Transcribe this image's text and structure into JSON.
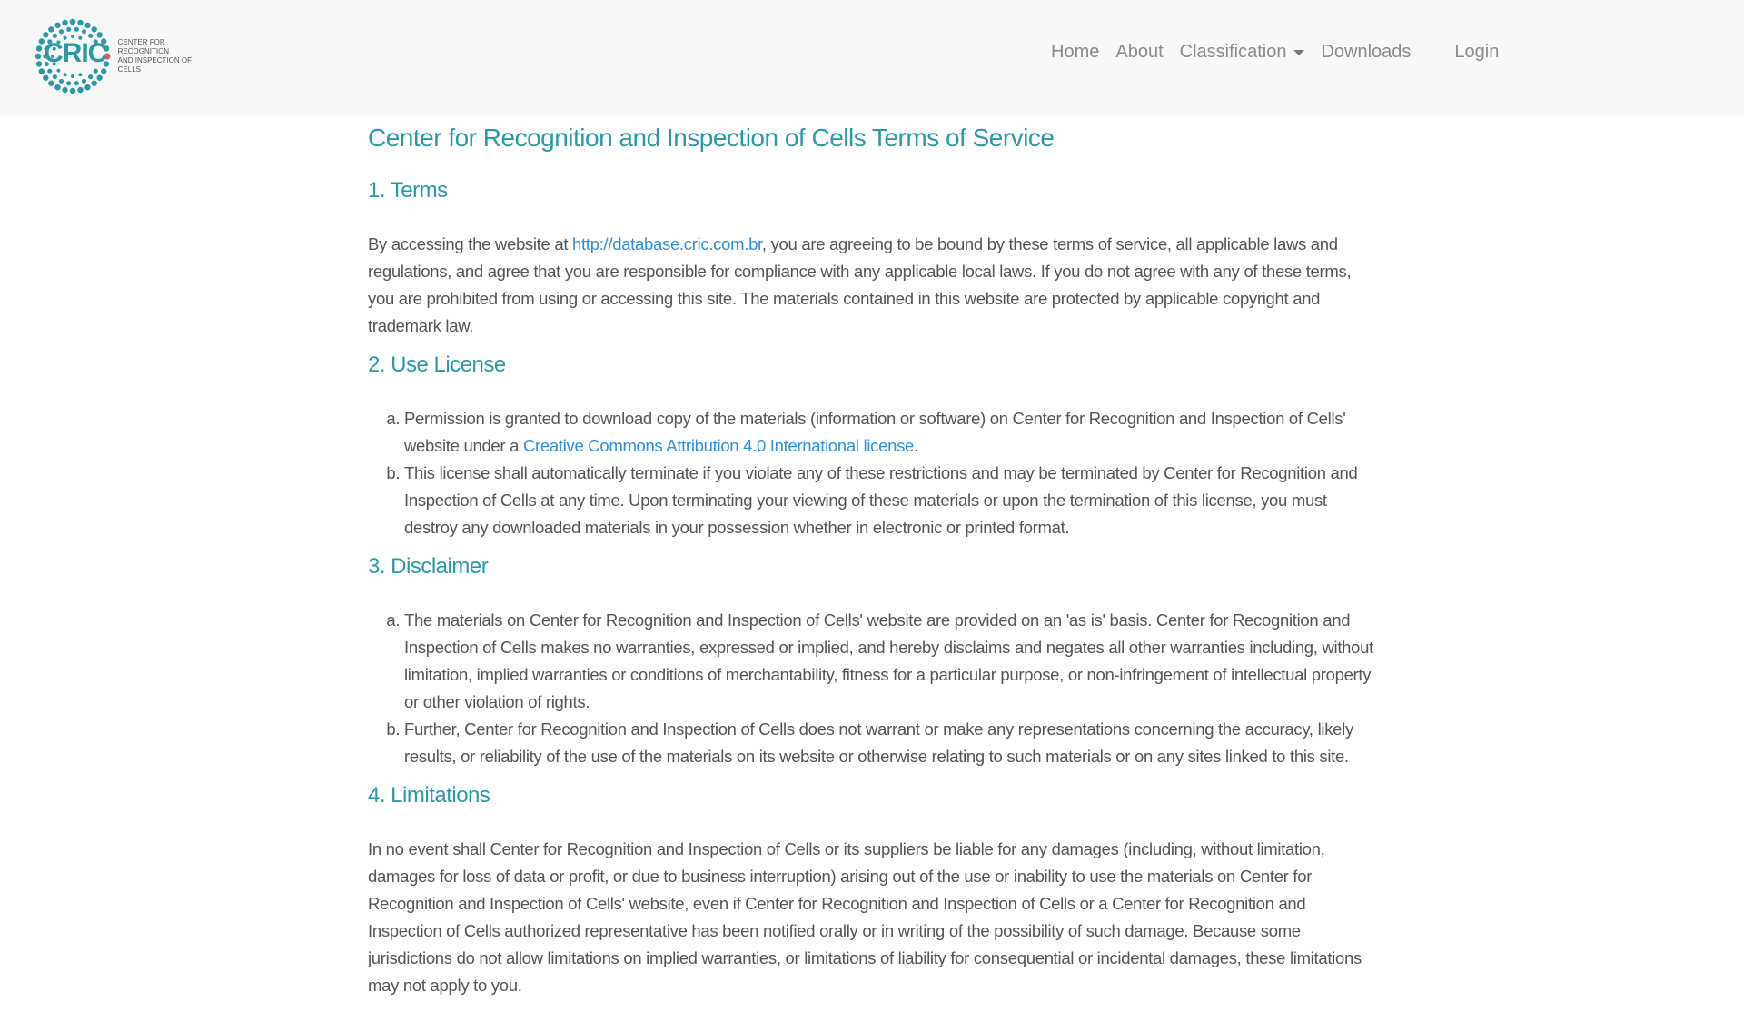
{
  "navbar": {
    "logo_letters": "CRIC",
    "logo_line1": "Center for Recognition",
    "logo_line2": "and Inspection of Cells",
    "links": [
      "Home",
      "About",
      "Classification",
      "Downloads"
    ],
    "login": "Login"
  },
  "page": {
    "title": "Center for Recognition and Inspection of Cells Terms of Service",
    "terms": {
      "heading": "1. Terms",
      "before_link": "By accessing the website at ",
      "link_text": "http://database.cric.com.br",
      "after_link": ", you are agreeing to be bound by these terms of service, all applicable laws and regulations, and agree that you are responsible for compliance with any applicable local laws. If you do not agree with any of these terms, you are prohibited from using or accessing this site. The materials contained in this website are protected by applicable copyright and trademark law."
    },
    "use_license": {
      "heading": "2. Use License",
      "item_a_before": "Permission is granted to download copy of the materials (information or software) on Center for Recognition and Inspection of Cells' website under a ",
      "item_a_link": "Creative Commons Attribution 4.0 International license",
      "item_a_after": ".",
      "item_b": "This license shall automatically terminate if you violate any of these restrictions and may be terminated by Center for Recognition and Inspection of Cells at any time. Upon terminating your viewing of these materials or upon the termination of this license, you must destroy any downloaded materials in your possession whether in electronic or printed format."
    },
    "disclaimer": {
      "heading": "3. Disclaimer",
      "item_a": "The materials on Center for Recognition and Inspection of Cells' website are provided on an 'as is' basis. Center for Recognition and Inspection of Cells makes no warranties, expressed or implied, and hereby disclaims and negates all other warranties including, without limitation, implied warranties or conditions of merchantability, fitness for a particular purpose, or non-infringement of intellectual property or other violation of rights.",
      "item_b": "Further, Center for Recognition and Inspection of Cells does not warrant or make any representations concerning the accuracy, likely results, or reliability of the use of the materials on its website or otherwise relating to such materials or on any sites linked to this site."
    },
    "limitations": {
      "heading": "4. Limitations",
      "text": "In no event shall Center for Recognition and Inspection of Cells or its suppliers be liable for any damages (including, without limitation, damages for loss of data or profit, or due to business interruption) arising out of the use or inability to use the materials on Center for Recognition and Inspection of Cells' website, even if Center for Recognition and Inspection of Cells or a Center for Recognition and Inspection of Cells authorized representative has been notified orally or in writing of the possibility of such damage. Because some jurisdictions do not allow limitations on implied warranties, or limitations of liability for consequential or incidental damages, these limitations may not apply to you."
    }
  },
  "colors": {
    "brand_teal": "#2a9aa6",
    "link_blue": "#2f8fd8",
    "logo_dot_red": "#e05a5a"
  }
}
